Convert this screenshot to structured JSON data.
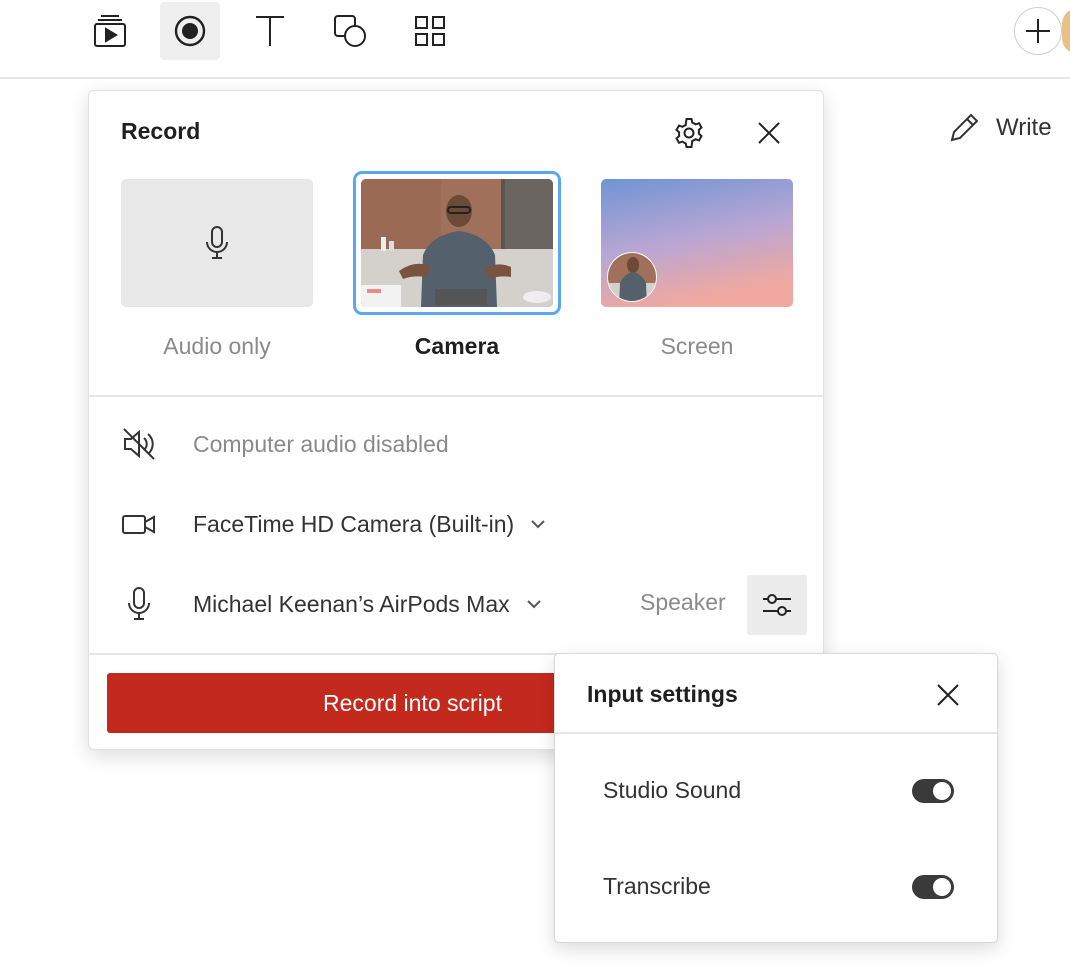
{
  "toolbar": {
    "tools": [
      {
        "icon": "media-library-icon",
        "active": false
      },
      {
        "icon": "record-icon",
        "active": true
      },
      {
        "icon": "text-icon",
        "active": false
      },
      {
        "icon": "shapes-icon",
        "active": false
      },
      {
        "icon": "grid-icon",
        "active": false
      }
    ],
    "add_icon": "plus-icon"
  },
  "write": {
    "label": "Write",
    "icon": "pencil-icon"
  },
  "record_panel": {
    "title": "Record",
    "modes": [
      {
        "label": "Audio only",
        "icon": "microphone-icon",
        "selected": false
      },
      {
        "label": "Camera",
        "selected": true
      },
      {
        "label": "Screen",
        "selected": false
      }
    ],
    "computer_audio": {
      "label": "Computer audio disabled",
      "icon": "speaker-muted-icon"
    },
    "camera_select": {
      "value": "FaceTime HD Camera (Built-in)",
      "icon": "video-camera-icon"
    },
    "mic_select": {
      "value": "Michael Keenan’s AirPods Max",
      "icon": "microphone-icon"
    },
    "speaker_label": "Speaker",
    "record_button": "Record into script",
    "colors": {
      "accent_red": "#c4291e",
      "selection_blue": "#5aa8ef"
    }
  },
  "input_settings": {
    "title": "Input settings",
    "options": [
      {
        "label": "Studio Sound",
        "enabled": true
      },
      {
        "label": "Transcribe",
        "enabled": true
      }
    ]
  }
}
